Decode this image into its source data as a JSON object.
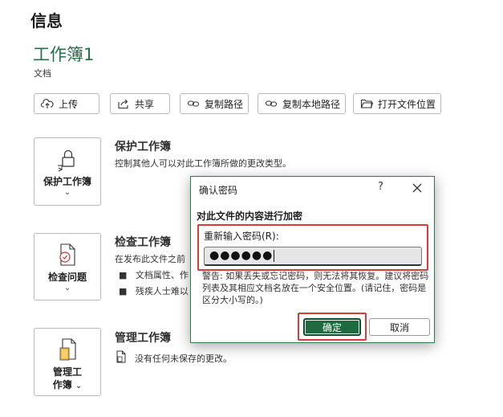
{
  "page": {
    "heading": "信息"
  },
  "workbook": {
    "title": "工作簿1",
    "location": "文档"
  },
  "toolbar": {
    "upload": "上传",
    "share": "共享",
    "copy_path": "复制路径",
    "copy_local_path": "复制本地路径",
    "open_location": "打开文件位置"
  },
  "protect": {
    "button_label": "保护工作簿",
    "title": "保护工作簿",
    "desc": "控制其他人可以对此工作簿所做的更改类型。"
  },
  "inspect": {
    "button_label": "检查问题",
    "title": "检查工作簿",
    "desc": "在发布此文件之前",
    "bullets": [
      "文档属性、作",
      "残疾人士难以"
    ]
  },
  "manage": {
    "button_label_1": "管理工",
    "button_label_2": "作簿",
    "title": "管理工作簿",
    "desc": "没有任何未保存的更改。"
  },
  "dialog": {
    "title": "确认密码",
    "help": "?",
    "heading": "对此文件的内容进行加密",
    "password_label": "重新输入密码(R):",
    "password_value": "●●●●●●",
    "warning": "警告: 如果丢失或忘记密码，则无法将其恢复。建议将密码列表及其相应文档名放在一个安全位置。(请记住，密码是区分大小写的。)",
    "ok": "确定",
    "cancel": "取消"
  },
  "colors": {
    "accent": "#217346",
    "highlight": "#d93b3b",
    "primary_button": "#1d6b3f"
  }
}
